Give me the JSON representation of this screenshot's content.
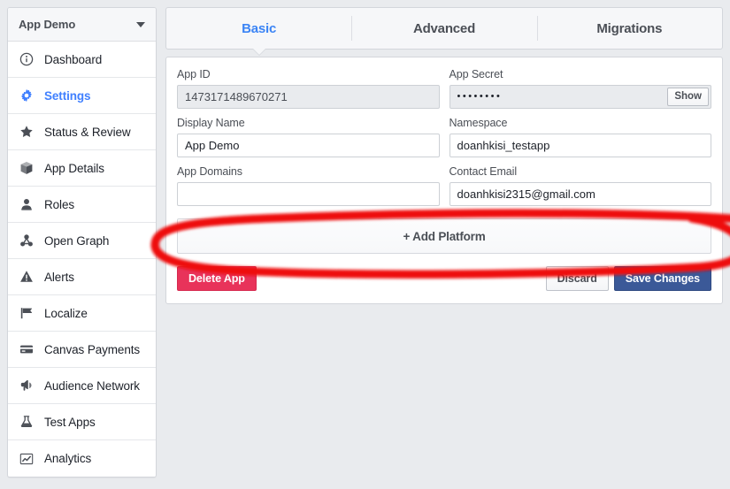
{
  "sidebar": {
    "header": {
      "title": "App Demo",
      "caret_icon": "chevron-down-icon"
    },
    "items": [
      {
        "label": "Dashboard",
        "icon": "info-circle-icon",
        "active": false
      },
      {
        "label": "Settings",
        "icon": "gear-icon",
        "active": true
      },
      {
        "label": "Status & Review",
        "icon": "star-icon",
        "active": false
      },
      {
        "label": "App Details",
        "icon": "box-icon",
        "active": false
      },
      {
        "label": "Roles",
        "icon": "person-icon",
        "active": false
      },
      {
        "label": "Open Graph",
        "icon": "graph-nodes-icon",
        "active": false
      },
      {
        "label": "Alerts",
        "icon": "warning-triangle-icon",
        "active": false
      },
      {
        "label": "Localize",
        "icon": "flag-icon",
        "active": false
      },
      {
        "label": "Canvas Payments",
        "icon": "credit-card-icon",
        "active": false
      },
      {
        "label": "Audience Network",
        "icon": "megaphone-icon",
        "active": false
      },
      {
        "label": "Test Apps",
        "icon": "flask-icon",
        "active": false
      },
      {
        "label": "Analytics",
        "icon": "line-chart-icon",
        "active": false
      }
    ]
  },
  "tabs": [
    {
      "label": "Basic",
      "active": true
    },
    {
      "label": "Advanced",
      "active": false
    },
    {
      "label": "Migrations",
      "active": false
    }
  ],
  "form": {
    "app_id": {
      "label": "App ID",
      "value": "1473171489670271",
      "placeholder": ""
    },
    "app_secret": {
      "label": "App Secret",
      "value": "••••••••",
      "show_label": "Show"
    },
    "display_name": {
      "label": "Display Name",
      "value": "App Demo",
      "placeholder": ""
    },
    "namespace": {
      "label": "Namespace",
      "value": "doanhkisi_testapp",
      "placeholder": ""
    },
    "app_domains": {
      "label": "App Domains",
      "value": "",
      "placeholder": ""
    },
    "contact_email": {
      "label": "Contact Email",
      "value": "doanhkisi2315@gmail.com",
      "placeholder": ""
    },
    "add_platform_label": "+ Add Platform"
  },
  "actions": {
    "delete_label": "Delete App",
    "discard_label": "Discard",
    "save_label": "Save Changes"
  },
  "colors": {
    "page_background": "#e9ebee",
    "accent_blue": "#4080ff",
    "tab_active": "#3b84f5",
    "save_button": "#3b5998",
    "delete_button": "#e8335a",
    "annotation_red": "#ee1111"
  },
  "annotation": {
    "shape": "hand-drawn-ellipse",
    "color": "#ee1111",
    "target": "+ Add Platform"
  }
}
